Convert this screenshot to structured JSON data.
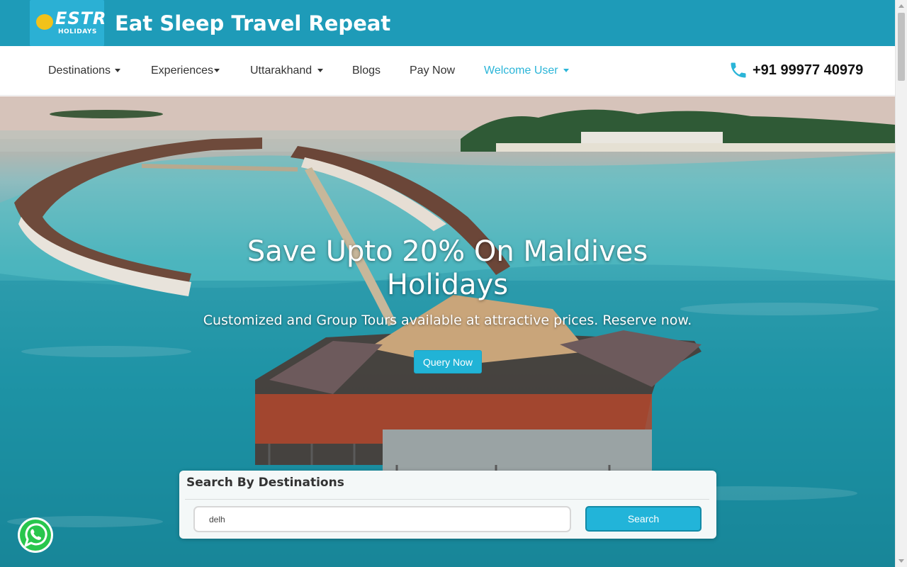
{
  "brand": {
    "logo_text": "ESTR",
    "logo_sub": "HOLIDAYS",
    "site_title": "Eat Sleep Travel Repeat"
  },
  "nav": {
    "items": [
      {
        "label": "Destinations",
        "has_dropdown": true
      },
      {
        "label": "Experiences",
        "has_dropdown": true
      },
      {
        "label": "Uttarakhand",
        "has_dropdown": true
      },
      {
        "label": "Blogs",
        "has_dropdown": false
      },
      {
        "label": "Pay Now",
        "has_dropdown": false
      },
      {
        "label": "Welcome User",
        "has_dropdown": true,
        "active": true
      }
    ],
    "phone": "+91 99977 40979"
  },
  "hero": {
    "headline": "Save Upto 20% On Maldives Holidays",
    "subtitle": "Customized and Group Tours available at attractive prices. Reserve now.",
    "cta_label": "Query Now"
  },
  "search": {
    "title": "Search By Destinations",
    "input_value": "delh",
    "button_label": "Search"
  },
  "icons": {
    "phone": "phone-icon",
    "whatsapp": "whatsapp-icon"
  },
  "colors": {
    "brand_bar": "#1e9bb8",
    "accent": "#22b4d9",
    "nav_active": "#2bb5d8",
    "logo_bg": "#2bb0d4"
  }
}
